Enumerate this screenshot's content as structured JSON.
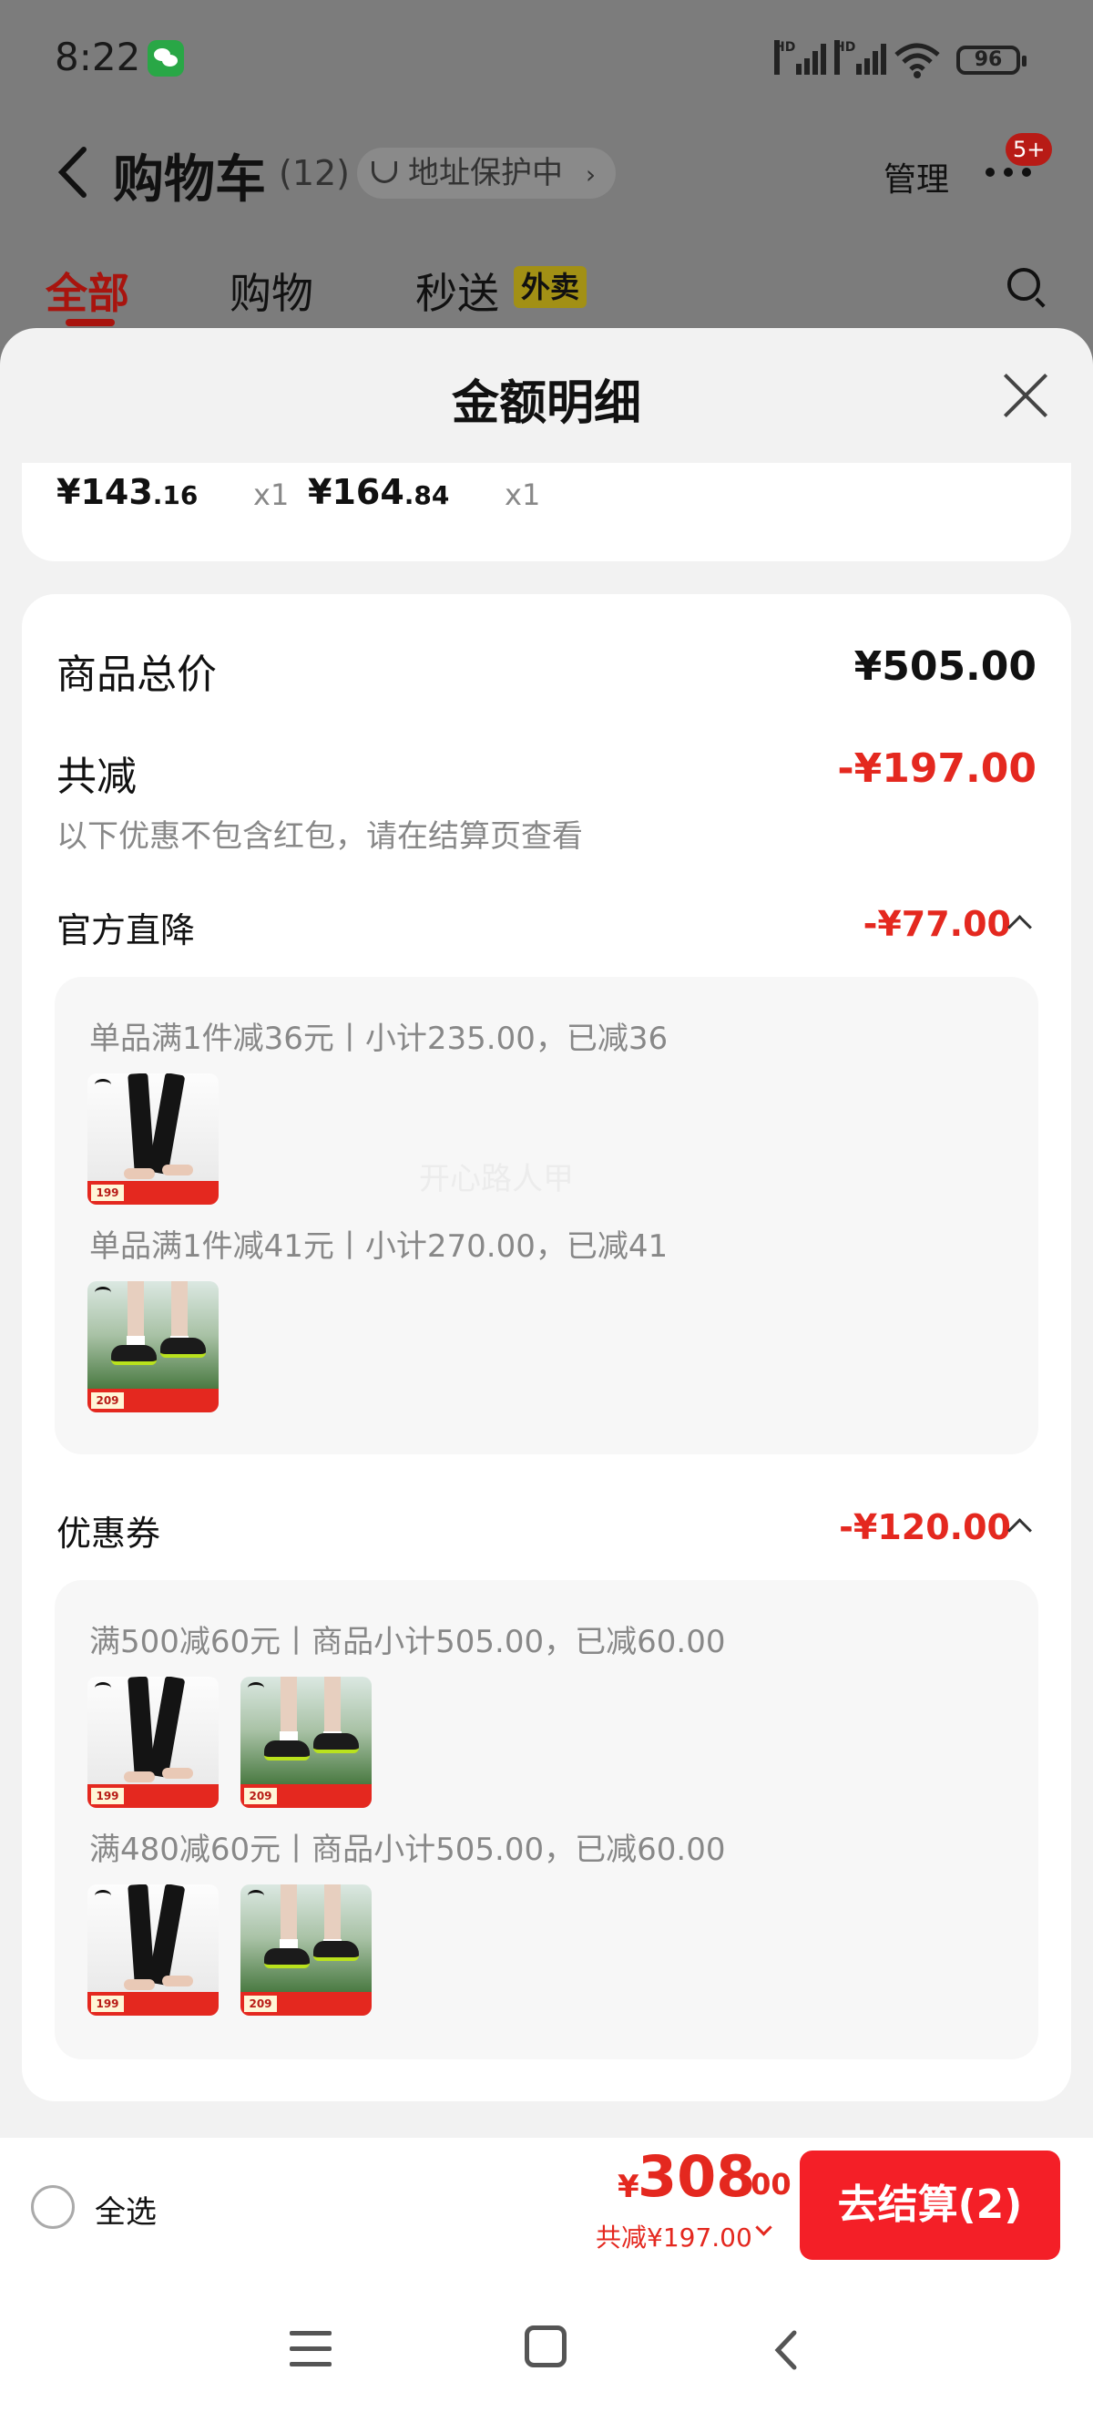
{
  "status": {
    "time": "8:22",
    "battery": "96",
    "signal_label": "HD"
  },
  "header": {
    "title": "购物车",
    "count": "(12)",
    "address_pill": "地址保护中",
    "address_chevron": "›",
    "manage": "管理",
    "badge": "5+"
  },
  "tabs": [
    {
      "label": "全部"
    },
    {
      "label": "购物"
    },
    {
      "label": "秒送"
    }
  ],
  "waimai_tag": "外卖",
  "sheet": {
    "title": "金额明细",
    "items": [
      {
        "price_int": "¥143",
        "price_dec": ".16",
        "qty": "x1"
      },
      {
        "price_int": "¥164",
        "price_dec": ".84",
        "qty": "x1"
      }
    ],
    "total_label": "商品总价",
    "total_value": "¥505.00",
    "reduce_label": "共减",
    "reduce_value": "-¥197.00",
    "reduce_note": "以下优惠不包含红包，请在结算页查看",
    "official": {
      "label": "官方直降",
      "value": "-¥77.00",
      "lines": [
        {
          "text": "单品满1件减36元丨小计235.00，已减36",
          "thumbs": [
            "pants"
          ]
        },
        {
          "text": "单品满1件减41元丨小计270.00，已减41",
          "thumbs": [
            "shoes"
          ]
        }
      ]
    },
    "coupon": {
      "label": "优惠券",
      "value": "-¥120.00",
      "lines": [
        {
          "text": "满500减60元丨商品小计505.00，已减60.00",
          "thumbs": [
            "pants",
            "shoes"
          ]
        },
        {
          "text": "满480减60元丨商品小计505.00，已减60.00",
          "thumbs": [
            "pants",
            "shoes"
          ]
        }
      ]
    },
    "watermark": "开心路人甲"
  },
  "thumb_prices": {
    "pants": "199",
    "shoes": "209"
  },
  "bottom": {
    "select_all": "全选",
    "currency": "¥",
    "total_int": "308",
    "total_dec": ".00",
    "discount": "共减¥197.00",
    "checkout": "去结算(2)"
  },
  "colors": {
    "accent": "#e4281f",
    "checkout": "#f41f27",
    "tab_active": "#a8140e"
  }
}
